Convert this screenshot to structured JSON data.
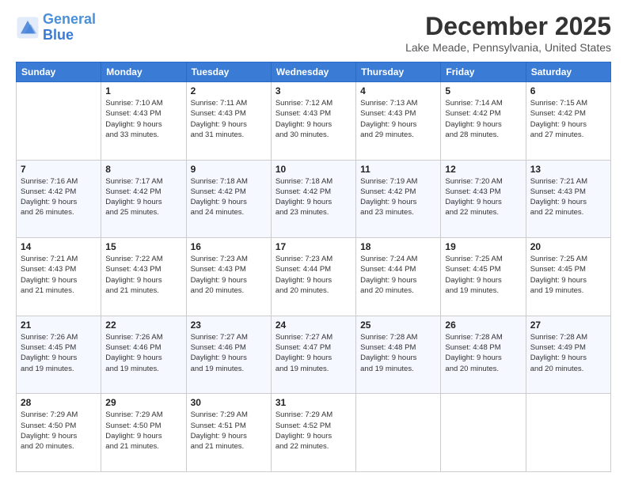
{
  "header": {
    "logo_line1": "General",
    "logo_line2": "Blue",
    "title": "December 2025",
    "subtitle": "Lake Meade, Pennsylvania, United States"
  },
  "weekdays": [
    "Sunday",
    "Monday",
    "Tuesday",
    "Wednesday",
    "Thursday",
    "Friday",
    "Saturday"
  ],
  "weeks": [
    [
      {
        "day": "",
        "info": ""
      },
      {
        "day": "1",
        "info": "Sunrise: 7:10 AM\nSunset: 4:43 PM\nDaylight: 9 hours\nand 33 minutes."
      },
      {
        "day": "2",
        "info": "Sunrise: 7:11 AM\nSunset: 4:43 PM\nDaylight: 9 hours\nand 31 minutes."
      },
      {
        "day": "3",
        "info": "Sunrise: 7:12 AM\nSunset: 4:43 PM\nDaylight: 9 hours\nand 30 minutes."
      },
      {
        "day": "4",
        "info": "Sunrise: 7:13 AM\nSunset: 4:43 PM\nDaylight: 9 hours\nand 29 minutes."
      },
      {
        "day": "5",
        "info": "Sunrise: 7:14 AM\nSunset: 4:42 PM\nDaylight: 9 hours\nand 28 minutes."
      },
      {
        "day": "6",
        "info": "Sunrise: 7:15 AM\nSunset: 4:42 PM\nDaylight: 9 hours\nand 27 minutes."
      }
    ],
    [
      {
        "day": "7",
        "info": "Sunrise: 7:16 AM\nSunset: 4:42 PM\nDaylight: 9 hours\nand 26 minutes."
      },
      {
        "day": "8",
        "info": "Sunrise: 7:17 AM\nSunset: 4:42 PM\nDaylight: 9 hours\nand 25 minutes."
      },
      {
        "day": "9",
        "info": "Sunrise: 7:18 AM\nSunset: 4:42 PM\nDaylight: 9 hours\nand 24 minutes."
      },
      {
        "day": "10",
        "info": "Sunrise: 7:18 AM\nSunset: 4:42 PM\nDaylight: 9 hours\nand 23 minutes."
      },
      {
        "day": "11",
        "info": "Sunrise: 7:19 AM\nSunset: 4:42 PM\nDaylight: 9 hours\nand 23 minutes."
      },
      {
        "day": "12",
        "info": "Sunrise: 7:20 AM\nSunset: 4:43 PM\nDaylight: 9 hours\nand 22 minutes."
      },
      {
        "day": "13",
        "info": "Sunrise: 7:21 AM\nSunset: 4:43 PM\nDaylight: 9 hours\nand 22 minutes."
      }
    ],
    [
      {
        "day": "14",
        "info": "Sunrise: 7:21 AM\nSunset: 4:43 PM\nDaylight: 9 hours\nand 21 minutes."
      },
      {
        "day": "15",
        "info": "Sunrise: 7:22 AM\nSunset: 4:43 PM\nDaylight: 9 hours\nand 21 minutes."
      },
      {
        "day": "16",
        "info": "Sunrise: 7:23 AM\nSunset: 4:43 PM\nDaylight: 9 hours\nand 20 minutes."
      },
      {
        "day": "17",
        "info": "Sunrise: 7:23 AM\nSunset: 4:44 PM\nDaylight: 9 hours\nand 20 minutes."
      },
      {
        "day": "18",
        "info": "Sunrise: 7:24 AM\nSunset: 4:44 PM\nDaylight: 9 hours\nand 20 minutes."
      },
      {
        "day": "19",
        "info": "Sunrise: 7:25 AM\nSunset: 4:45 PM\nDaylight: 9 hours\nand 19 minutes."
      },
      {
        "day": "20",
        "info": "Sunrise: 7:25 AM\nSunset: 4:45 PM\nDaylight: 9 hours\nand 19 minutes."
      }
    ],
    [
      {
        "day": "21",
        "info": "Sunrise: 7:26 AM\nSunset: 4:45 PM\nDaylight: 9 hours\nand 19 minutes."
      },
      {
        "day": "22",
        "info": "Sunrise: 7:26 AM\nSunset: 4:46 PM\nDaylight: 9 hours\nand 19 minutes."
      },
      {
        "day": "23",
        "info": "Sunrise: 7:27 AM\nSunset: 4:46 PM\nDaylight: 9 hours\nand 19 minutes."
      },
      {
        "day": "24",
        "info": "Sunrise: 7:27 AM\nSunset: 4:47 PM\nDaylight: 9 hours\nand 19 minutes."
      },
      {
        "day": "25",
        "info": "Sunrise: 7:28 AM\nSunset: 4:48 PM\nDaylight: 9 hours\nand 19 minutes."
      },
      {
        "day": "26",
        "info": "Sunrise: 7:28 AM\nSunset: 4:48 PM\nDaylight: 9 hours\nand 20 minutes."
      },
      {
        "day": "27",
        "info": "Sunrise: 7:28 AM\nSunset: 4:49 PM\nDaylight: 9 hours\nand 20 minutes."
      }
    ],
    [
      {
        "day": "28",
        "info": "Sunrise: 7:29 AM\nSunset: 4:50 PM\nDaylight: 9 hours\nand 20 minutes."
      },
      {
        "day": "29",
        "info": "Sunrise: 7:29 AM\nSunset: 4:50 PM\nDaylight: 9 hours\nand 21 minutes."
      },
      {
        "day": "30",
        "info": "Sunrise: 7:29 AM\nSunset: 4:51 PM\nDaylight: 9 hours\nand 21 minutes."
      },
      {
        "day": "31",
        "info": "Sunrise: 7:29 AM\nSunset: 4:52 PM\nDaylight: 9 hours\nand 22 minutes."
      },
      {
        "day": "",
        "info": ""
      },
      {
        "day": "",
        "info": ""
      },
      {
        "day": "",
        "info": ""
      }
    ]
  ]
}
